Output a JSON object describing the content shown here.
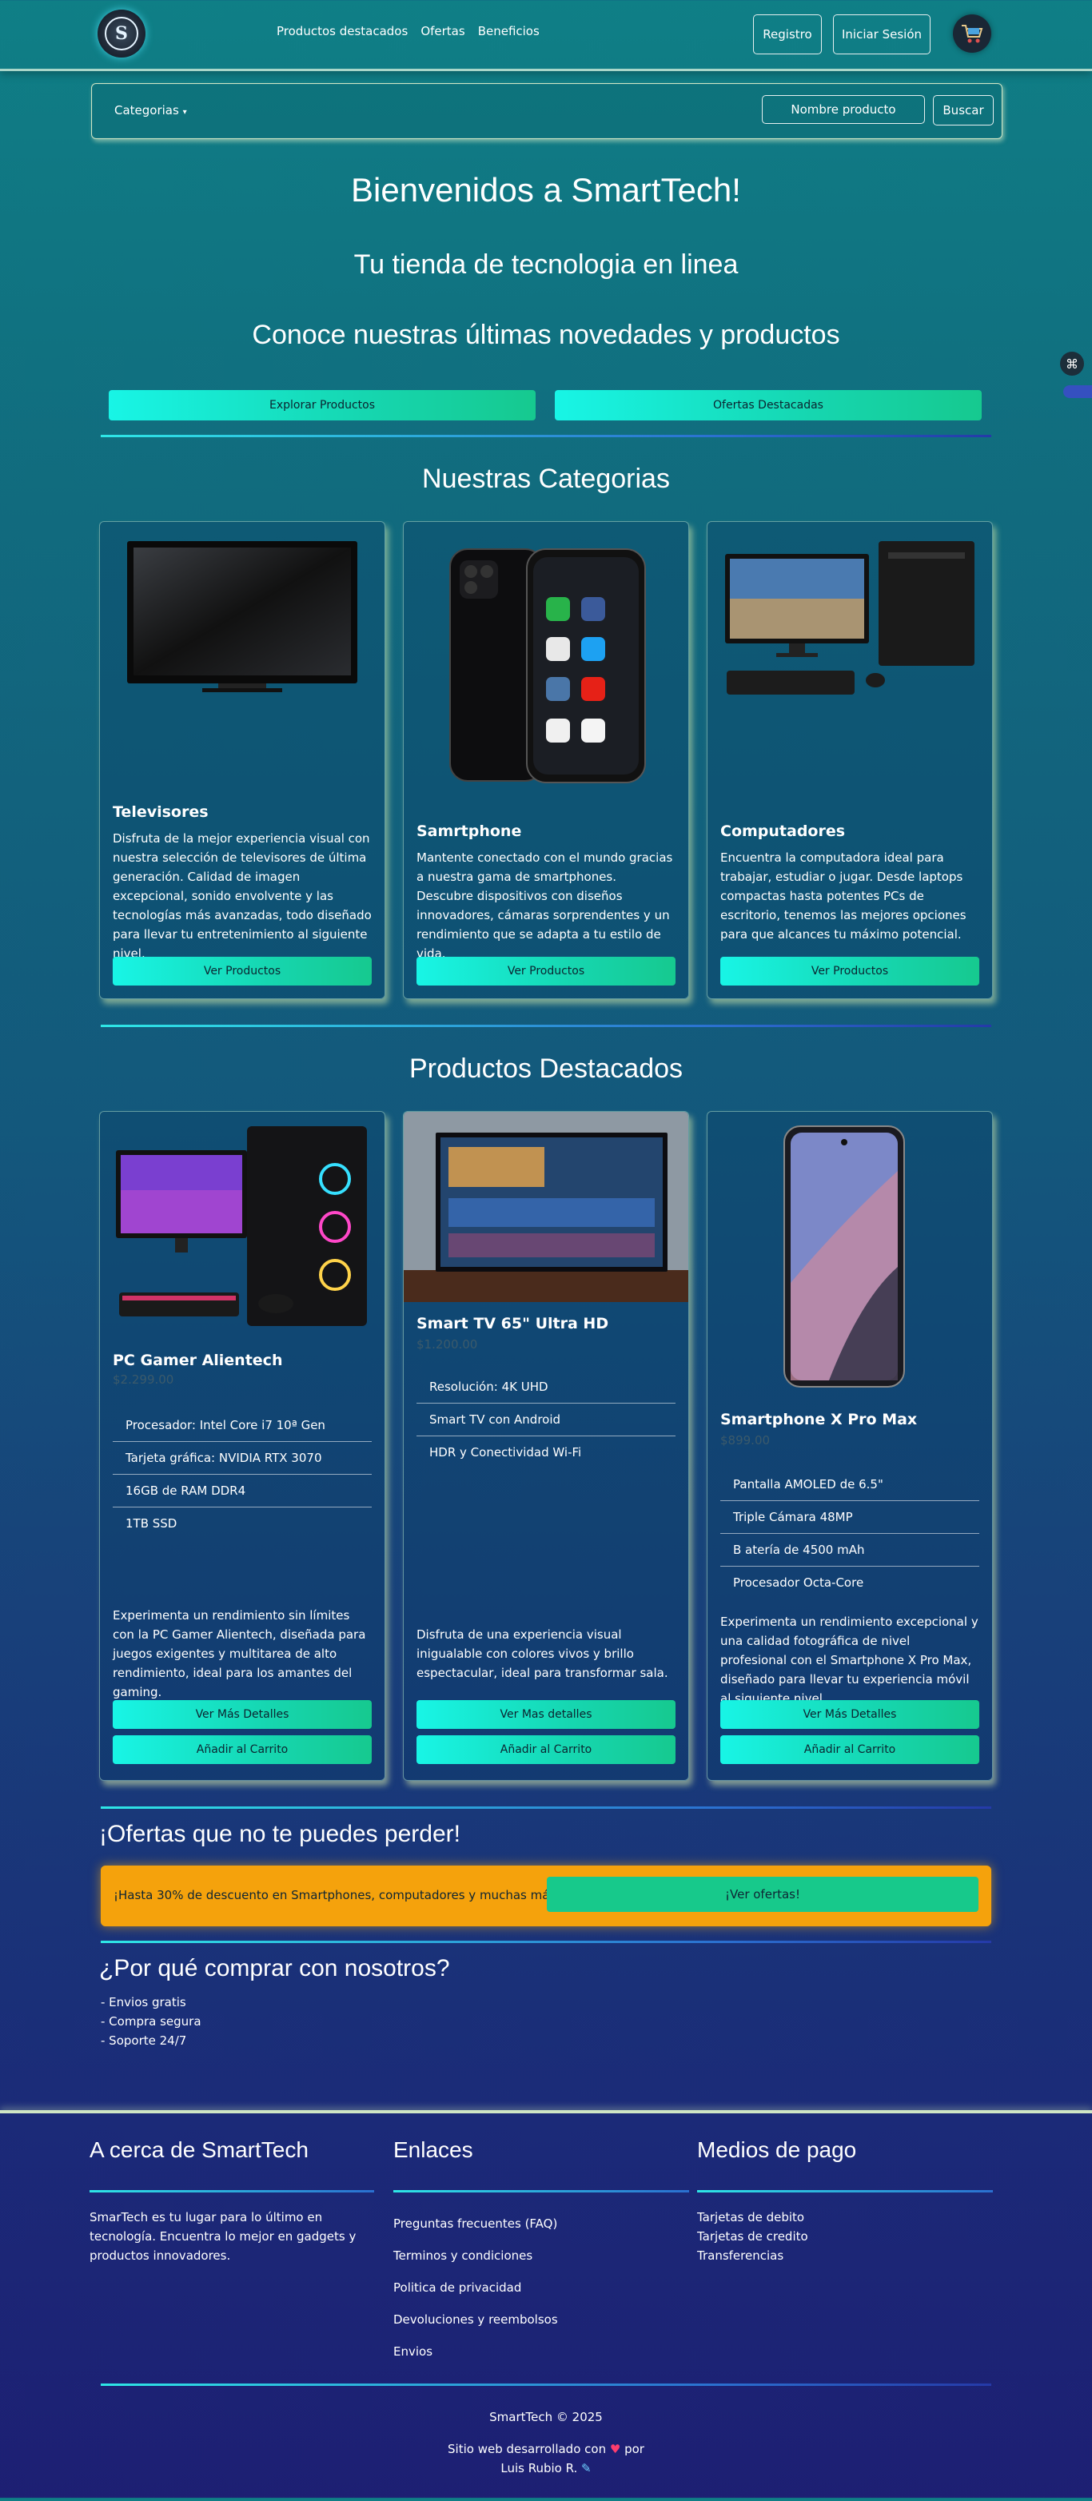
{
  "nav": {
    "links": [
      "Productos destacados",
      "Ofertas",
      "Beneficios"
    ],
    "register": "Registro",
    "login": "Iniciar Sesión"
  },
  "search": {
    "categories": "Categorias",
    "placeholder": "Nombre producto",
    "button": "Buscar"
  },
  "hero": {
    "title": "Bienvenidos a SmartTech!",
    "subtitle": "Tu tienda de tecnologia en linea",
    "tagline": "Conoce nuestras últimas novedades y productos",
    "btn_explore": "Explorar Productos",
    "btn_offers": "Ofertas Destacadas"
  },
  "categories_section": {
    "title": "Nuestras Categorias",
    "items": [
      {
        "title": "Televisores",
        "text": "Disfruta de la mejor experiencia visual con nuestra selección de televisores de última generación. Calidad de imagen excepcional, sonido envolvente y las tecnologías más avanzadas, todo diseñado para llevar tu entretenimiento al siguiente nivel.",
        "button": "Ver Productos"
      },
      {
        "title": "Samrtphone",
        "text": "Mantente conectado con el mundo gracias a nuestra gama de smartphones. Descubre dispositivos con diseños innovadores, cámaras sorprendentes y un rendimiento que se adapta a tu estilo de vida.",
        "button": "Ver Productos"
      },
      {
        "title": "Computadores",
        "text": "Encuentra la computadora ideal para trabajar, estudiar o jugar. Desde laptops compactas hasta potentes PCs de escritorio, tenemos las mejores opciones para que alcances tu máximo potencial.",
        "button": "Ver Productos"
      }
    ]
  },
  "featured_section": {
    "title": "Productos Destacados",
    "items": [
      {
        "title": "PC Gamer Alientech",
        "price": "$2.299.00",
        "specs": [
          "Procesador: Intel Core i7 10ª Gen",
          "Tarjeta gráfica: NVIDIA RTX 3070",
          "16GB de RAM DDR4",
          "1TB SSD"
        ],
        "text": "Experimenta un rendimiento sin límites con la PC Gamer Alientech, diseñada para juegos exigentes y multitarea de alto rendimiento, ideal para los amantes del gaming.",
        "details": "Ver Más Detalles",
        "cart": "Añadir al Carrito"
      },
      {
        "title": "Smart TV 65\" Ultra HD",
        "price": "$1.200.00",
        "specs": [
          "Resolución: 4K UHD",
          "Smart TV con Android",
          "HDR y Conectividad Wi-Fi"
        ],
        "text": "Disfruta de una experiencia visual inigualable con colores vivos y brillo espectacular, ideal para transformar sala.",
        "details": "Ver Mas detalles",
        "cart": "Añadir al Carrito"
      },
      {
        "title": "Smartphone X Pro Max",
        "price": "$899.00",
        "specs": [
          "Pantalla AMOLED de 6.5\"",
          "Triple Cámara 48MP",
          "B atería de 4500 mAh",
          "Procesador Octa-Core"
        ],
        "text": "Experimenta un rendimiento excepcional y una calidad fotográfica de nivel profesional con el Smartphone X Pro Max, diseñado para llevar tu experiencia móvil al siguiente nivel",
        "details": "Ver Más Detalles",
        "cart": "Añadir al Carrito"
      }
    ]
  },
  "offers": {
    "title": "¡Ofertas que no te puedes perder!",
    "text": "¡Hasta 30% de descuento en Smartphones, computadores y muchas más!",
    "button": "¡Ver ofertas!"
  },
  "why": {
    "title": "¿Por qué comprar con nosotros?",
    "items": [
      "- Envios gratis",
      "- Compra segura",
      "- Soporte 24/7"
    ]
  },
  "footer": {
    "about_title": "A cerca de SmartTech",
    "about_text": "SmarTech es tu lugar para lo último en tecnología. Encuentra lo mejor en gadgets y productos innovadores.",
    "links_title": "Enlaces",
    "links": [
      "Preguntas frecuentes (FAQ)",
      "Terminos y condiciones",
      "Politica de privacidad",
      "Devoluciones y reembolsos",
      "Envios"
    ],
    "payment_title": "Medios de pago",
    "payments": [
      "Tarjetas de debito",
      "Tarjetas de credito",
      "Transferencias"
    ],
    "copyright": "SmartTech © 2025",
    "credit_prefix": "Sitio web desarrollado con",
    "credit_suffix": "por",
    "author": "Luis Rubio R."
  },
  "colors": {
    "accent": "#18f5e6",
    "accent_end": "#16c98f",
    "offer": "#f5a20c"
  }
}
